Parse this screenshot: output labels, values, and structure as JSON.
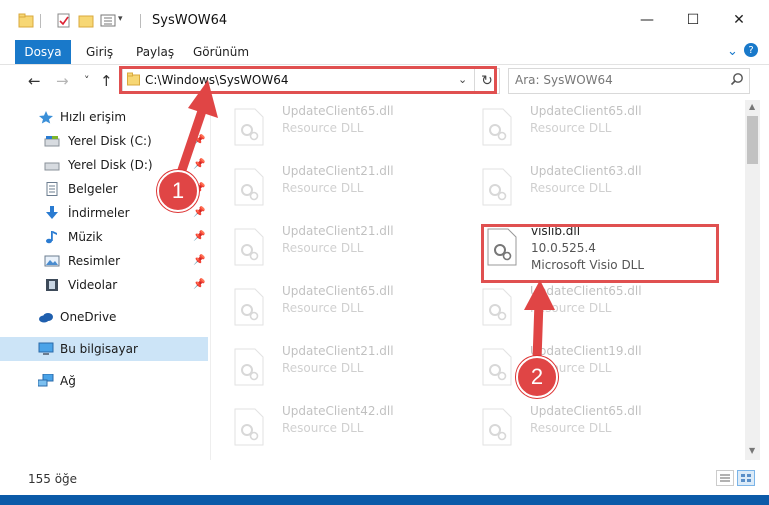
{
  "window": {
    "title": "SysWOW64",
    "controls": {
      "minimize": "—",
      "maximize": "☐",
      "close": "✕"
    }
  },
  "ribbon": {
    "tabs": [
      "Dosya",
      "Giriş",
      "Paylaş",
      "Görünüm"
    ],
    "expand_glyph": "⌄",
    "help_glyph": "?"
  },
  "navigation": {
    "back": "←",
    "forward": "→",
    "recent": "˅",
    "up": "↑",
    "address": "C:\\Windows\\SysWOW64",
    "refresh": "↻",
    "dropdown": "⌄",
    "search_placeholder": "Ara: SysWOW64"
  },
  "sidebar": {
    "items": [
      {
        "label": "Hızlı erişim",
        "icon": "star-icon",
        "pinned": false,
        "root": true
      },
      {
        "label": "Yerel Disk (C:)",
        "icon": "drive-icon",
        "pinned": true
      },
      {
        "label": "Yerel Disk (D:)",
        "icon": "drive-icon",
        "pinned": true
      },
      {
        "label": "Belgeler",
        "icon": "documents-icon",
        "pinned": true
      },
      {
        "label": "İndirmeler",
        "icon": "download-icon",
        "pinned": true
      },
      {
        "label": "Müzik",
        "icon": "music-icon",
        "pinned": true
      },
      {
        "label": "Resimler",
        "icon": "pictures-icon",
        "pinned": true
      },
      {
        "label": "Videolar",
        "icon": "videos-icon",
        "pinned": true
      },
      {
        "label": "OneDrive",
        "icon": "cloud-icon",
        "pinned": false,
        "root": true
      },
      {
        "label": "Bu bilgisayar",
        "icon": "computer-icon",
        "pinned": false,
        "root": true,
        "selected": true
      },
      {
        "label": "Ağ",
        "icon": "network-icon",
        "pinned": false,
        "root": true
      }
    ]
  },
  "files": [
    {
      "name": "UpdateClient65.dll",
      "line2": "Resource DLL",
      "line3": "",
      "ghost": true
    },
    {
      "name": "UpdateClient65.dll",
      "line2": "Resource DLL",
      "line3": "",
      "ghost": true
    },
    {
      "name": "UpdateClient21.dll",
      "line2": "Resource DLL",
      "line3": "",
      "ghost": true
    },
    {
      "name": "UpdateClient63.dll",
      "line2": "Resource DLL",
      "line3": "",
      "ghost": true
    },
    {
      "name": "UpdateClient21.dll",
      "line2": "Resource DLL",
      "line3": "",
      "ghost": true
    },
    {
      "name": "vislib.dll",
      "line2": "10.0.525.4",
      "line3": "Microsoft Visio DLL",
      "ghost": false
    },
    {
      "name": "UpdateClient65.dll",
      "line2": "Resource DLL",
      "line3": "",
      "ghost": true
    },
    {
      "name": "UpdateClient65.dll",
      "line2": "Resource DLL",
      "line3": "",
      "ghost": true
    },
    {
      "name": "UpdateClient21.dll",
      "line2": "Resource DLL",
      "line3": "",
      "ghost": true
    },
    {
      "name": "UpdateClient19.dll",
      "line2": "Resource DLL",
      "line3": "",
      "ghost": true
    },
    {
      "name": "UpdateClient42.dll",
      "line2": "Resource DLL",
      "line3": "",
      "ghost": true
    },
    {
      "name": "UpdateClient65.dll",
      "line2": "Resource DLL",
      "line3": "",
      "ghost": true
    }
  ],
  "status": {
    "count": "155 öğe"
  },
  "annotations": {
    "step1": "1",
    "step2": "2"
  },
  "colors": {
    "accent": "#1979ca",
    "highlight": "#e05050",
    "selection": "#cce4f7",
    "arrow": "#e04545"
  }
}
